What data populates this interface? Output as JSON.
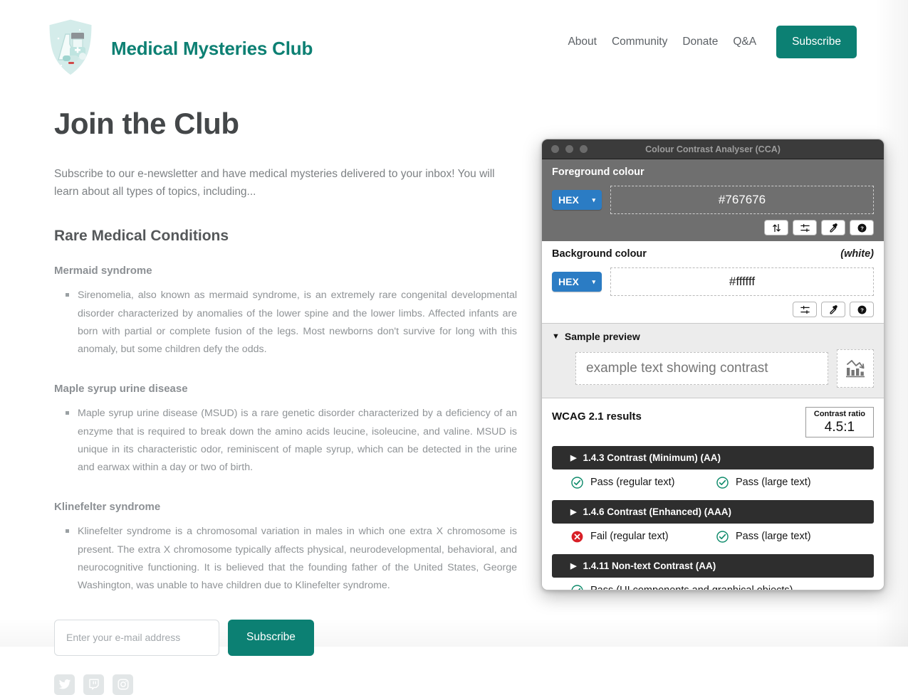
{
  "header": {
    "logo_icon": "shield-lab-icon",
    "brand": "Medical Mysteries Club",
    "nav": [
      {
        "label": "About"
      },
      {
        "label": "Community"
      },
      {
        "label": "Donate"
      },
      {
        "label": "Q&A"
      }
    ],
    "subscribe_label": "Subscribe",
    "brand_color": "#0d8073",
    "button_color": "#0c8073"
  },
  "article": {
    "title": "Join the Club",
    "lede": "Subscribe to our e-newsletter and have medical mysteries delivered to your inbox! You will learn about all types of topics, including...",
    "section_title": "Rare Medical Conditions",
    "conditions": [
      {
        "name": "Mermaid syndrome",
        "body": "Sirenomelia, also known as mermaid syndrome, is an extremely rare congenital developmental disorder characterized by anomalies of the lower spine and the lower limbs. Affected infants are born with partial or complete fusion of the legs. Most newborns don't survive for long with this anomaly, but some children defy the odds."
      },
      {
        "name": "Maple syrup urine disease",
        "body": "Maple syrup urine disease (MSUD) is a rare genetic disorder characterized by a deficiency of an enzyme that is required to break down the amino acids leucine, isoleucine, and valine. MSUD is unique in its characteristic odor, reminiscent of maple syrup, which can be detected in the urine and earwax within a day or two of birth."
      },
      {
        "name": "Klinefelter syndrome",
        "body": "Klinefelter syndrome is a chromosomal variation in males in which one extra X chromosome is present. The extra X chromosome typically affects physical, neurodevelopmental, behavioral, and neurocognitive functioning. It is believed that the founding father of the United States, George Washington, was unable to have children due to Klinefelter syndrome."
      }
    ],
    "form": {
      "email_placeholder": "Enter your e-mail address",
      "email_value": "",
      "submit_label": "Subscribe"
    },
    "social": [
      {
        "icon": "twitter-icon",
        "name": "Twitter"
      },
      {
        "icon": "twitch-icon",
        "name": "Twitch"
      },
      {
        "icon": "instagram-icon",
        "name": "Instagram"
      }
    ]
  },
  "cca": {
    "window_title": "Colour Contrast Analyser (CCA)",
    "foreground": {
      "label": "Foreground colour",
      "format": "HEX",
      "value": "#767676",
      "buttons": [
        {
          "icon": "swap-arrows-icon"
        },
        {
          "icon": "sliders-icon"
        },
        {
          "icon": "eyedropper-icon"
        },
        {
          "icon": "help-icon"
        }
      ]
    },
    "background": {
      "label": "Background colour",
      "note": "(white)",
      "format": "HEX",
      "value": "#ffffff",
      "buttons": [
        {
          "icon": "sliders-icon"
        },
        {
          "icon": "eyedropper-icon"
        },
        {
          "icon": "help-icon"
        }
      ]
    },
    "preview": {
      "disclosure_label": "Sample preview",
      "disclosure_glyph": "▼",
      "sample_text": "example text showing contrast",
      "graphic_icon": "bar-line-chart-icon"
    },
    "results": {
      "title": "WCAG 2.1 results",
      "ratio_label": "Contrast ratio",
      "ratio_value": "4.5:1",
      "criteria": [
        {
          "name": "1.4.3 Contrast (Minimum) (AA)",
          "glyph": "▶",
          "outcomes": [
            {
              "status": "pass",
              "text": "Pass (regular text)"
            },
            {
              "status": "pass",
              "text": "Pass (large text)"
            }
          ]
        },
        {
          "name": "1.4.6 Contrast (Enhanced) (AAA)",
          "glyph": "▶",
          "outcomes": [
            {
              "status": "fail",
              "text": "Fail (regular text)"
            },
            {
              "status": "pass",
              "text": "Pass (large text)"
            }
          ]
        },
        {
          "name": "1.4.11 Non-text Contrast (AA)",
          "glyph": "▶",
          "outcomes": [
            {
              "status": "pass",
              "text": "Pass (UI components and graphical objects)"
            }
          ]
        }
      ],
      "pass_color": "#0d8a6a",
      "fail_color": "#d81f26"
    }
  }
}
